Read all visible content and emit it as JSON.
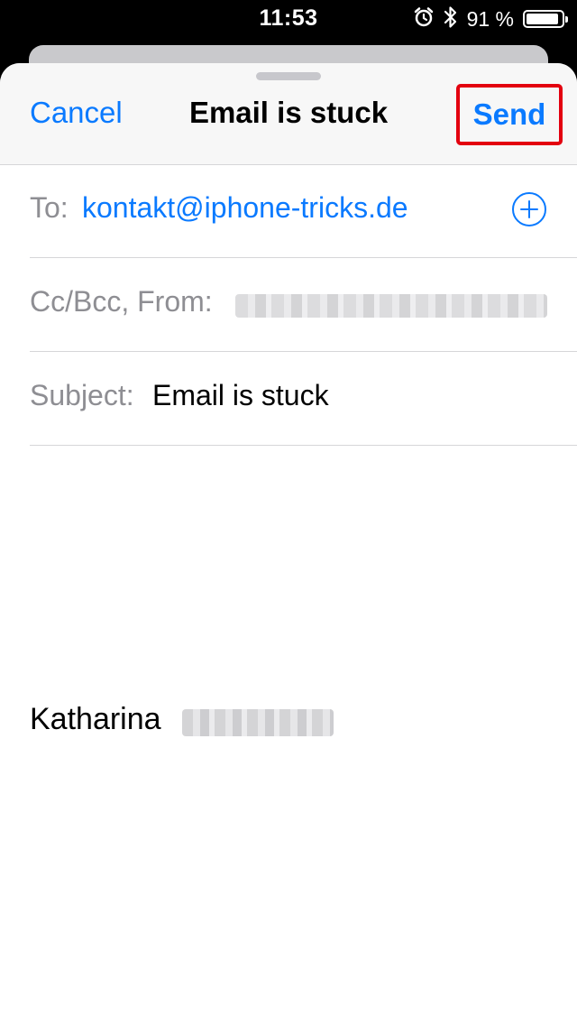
{
  "status_bar": {
    "time": "11:53",
    "battery_percent_text": "91 %",
    "battery_level": 0.91,
    "icons": [
      "alarm-icon",
      "bluetooth-icon",
      "battery-icon"
    ]
  },
  "compose": {
    "cancel_label": "Cancel",
    "title": "Email is stuck",
    "send_label": "Send",
    "to_label": "To:",
    "to_value": "kontakt@iphone-tricks.de",
    "cc_label": "Cc/Bcc, From:",
    "subject_label": "Subject:",
    "subject_value": "Email is stuck",
    "signature_first_name": "Katharina"
  },
  "colors": {
    "accent": "#0a7aff",
    "highlight_border": "#e3000f",
    "label_gray": "#8e8e93"
  }
}
